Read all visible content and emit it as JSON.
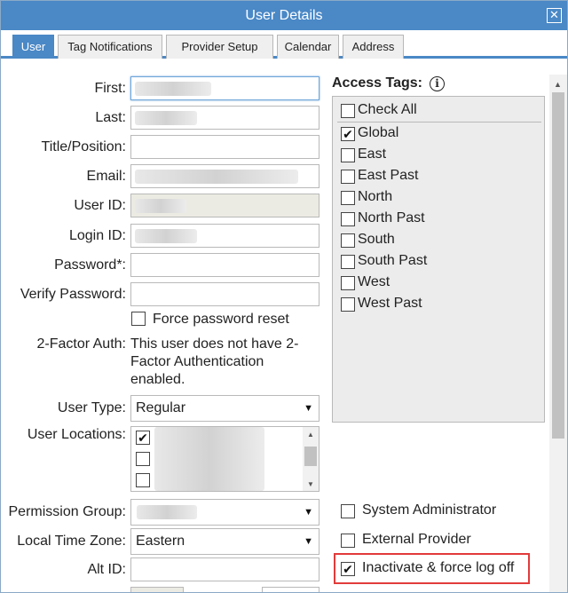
{
  "dialog": {
    "title": "User Details"
  },
  "tabs": [
    {
      "label": "User",
      "active": true
    },
    {
      "label": "Tag Notifications",
      "active": false
    },
    {
      "label": "Provider Setup",
      "active": false
    },
    {
      "label": "Calendar",
      "active": false
    },
    {
      "label": "Address",
      "active": false
    }
  ],
  "form": {
    "first_label": "First:",
    "last_label": "Last:",
    "title_label": "Title/Position:",
    "email_label": "Email:",
    "userid_label": "User ID:",
    "loginid_label": "Login ID:",
    "password_label": "Password*:",
    "verify_label": "Verify Password:",
    "force_reset_label": "Force password reset",
    "twofa_label": "2-Factor Auth:",
    "twofa_text": "This user does not have 2-Factor Authentication enabled.",
    "usertype_label": "User Type:",
    "usertype_value": "Regular",
    "locations_label": "User Locations:",
    "permgroup_label": "Permission Group:",
    "timezone_label": "Local Time Zone:",
    "timezone_value": "Eastern",
    "altid_label": "Alt ID:"
  },
  "access_tags": {
    "title": "Access Tags:",
    "check_all": "Check All",
    "items": [
      {
        "label": "Global",
        "checked": true
      },
      {
        "label": "East",
        "checked": false
      },
      {
        "label": "East Past",
        "checked": false
      },
      {
        "label": "North",
        "checked": false
      },
      {
        "label": "North Past",
        "checked": false
      },
      {
        "label": "South",
        "checked": false
      },
      {
        "label": "South Past",
        "checked": false
      },
      {
        "label": "West",
        "checked": false
      },
      {
        "label": "West Past",
        "checked": false
      }
    ]
  },
  "options": {
    "sysadmin_label": "System Administrator",
    "external_label": "External Provider",
    "inactivate_label": "Inactivate & force log off"
  },
  "colors": {
    "accent": "#4a88c6",
    "highlight": "#e23b3b"
  }
}
